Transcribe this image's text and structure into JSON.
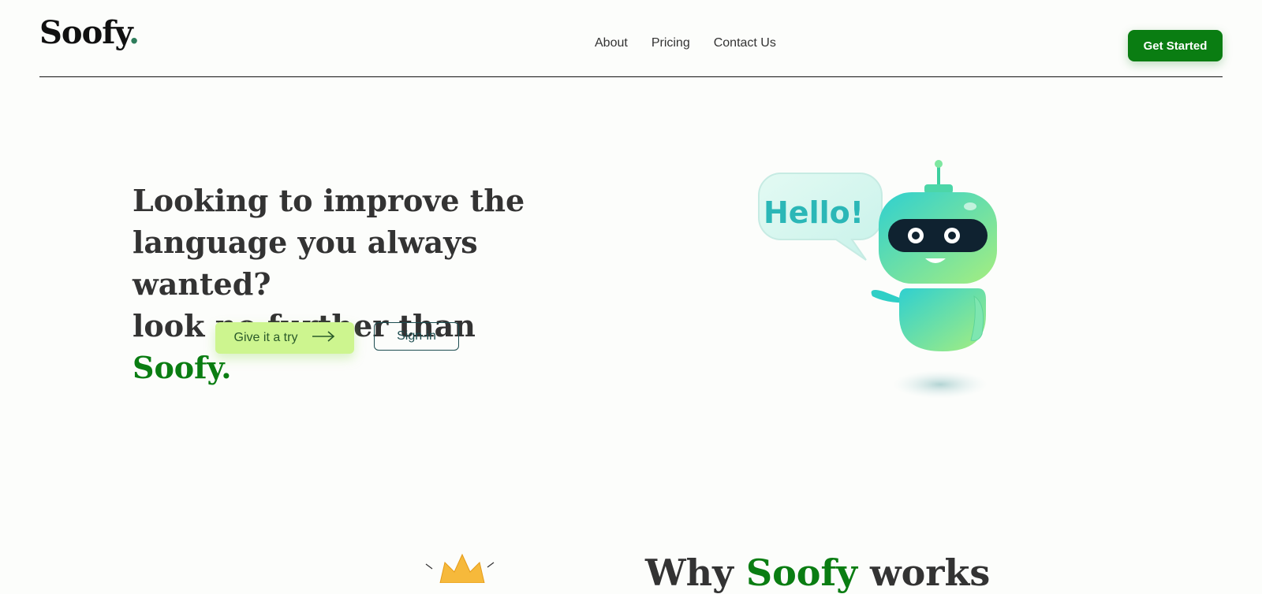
{
  "header": {
    "logo_text": "Soofy",
    "logo_dot": ".",
    "nav": [
      "About",
      "Pricing",
      "Contact Us"
    ],
    "cta": "Get Started"
  },
  "hero": {
    "line1": "Looking to improve the",
    "line2": "language you always wanted?",
    "line3_prefix": "look no further than ",
    "line3_brand": "Soofy.",
    "try_button": "Give it a try",
    "signin_button": "Sign-in"
  },
  "illustration": {
    "bubble_text": "Hello!"
  },
  "section": {
    "title_prefix": "Why ",
    "title_brand": "Soofy",
    "title_suffix": " works"
  },
  "colors": {
    "brand_green": "#0a7d12",
    "cta_light": "#cdf58f",
    "outline": "#1d4d50",
    "background": "#fcfdfb"
  },
  "icons": {
    "try_button_icon": "arrow-right-icon"
  }
}
